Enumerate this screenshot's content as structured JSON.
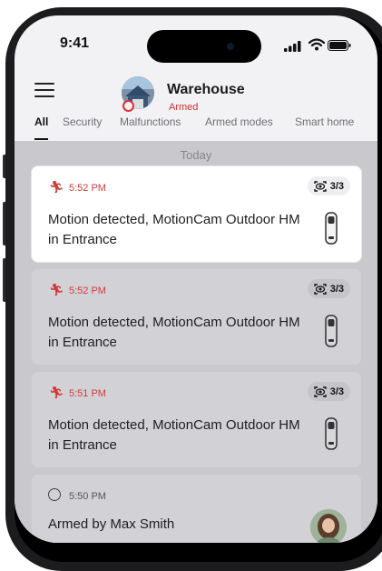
{
  "status_bar": {
    "time": "9:41"
  },
  "header": {
    "menu_icon": "menu-icon",
    "hub_name": "Warehouse",
    "hub_status": "Armed"
  },
  "tabs": [
    {
      "label": "All",
      "active": true
    },
    {
      "label": "Security",
      "active": false
    },
    {
      "label": "Malfunctions",
      "active": false
    },
    {
      "label": "Armed modes",
      "active": false
    },
    {
      "label": "Smart home",
      "active": false
    }
  ],
  "feed": {
    "day_label": "Today",
    "events": [
      {
        "time": "5:52 PM",
        "text": "Motion detected, MotionCam Outdoor HM in Entrance",
        "count": "3/3",
        "icon": "motion-icon",
        "highlighted": true
      },
      {
        "time": "5:52 PM",
        "text": "Motion detected, MotionCam Outdoor HM in Entrance",
        "count": "3/3",
        "icon": "motion-icon",
        "highlighted": false
      },
      {
        "time": "5:51 PM",
        "text": "Motion detected, MotionCam Outdoor HM in Entrance",
        "count": "3/3",
        "icon": "motion-icon",
        "highlighted": false
      },
      {
        "time": "5:50 PM",
        "text": "Armed by Max Smith",
        "icon": "armed-ring-icon",
        "highlighted": false
      }
    ]
  },
  "colors": {
    "alarm_red": "#d13b3b",
    "background": "#f2f2f4",
    "dimmed_feed": "#c9c9cd"
  }
}
